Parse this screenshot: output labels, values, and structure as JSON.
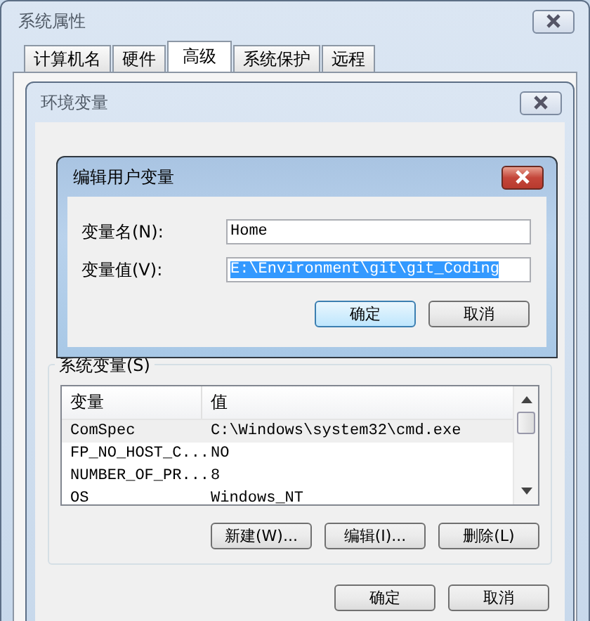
{
  "system_properties": {
    "title": "系统属性"
  },
  "tabs": [
    {
      "label": "计算机名",
      "selected": false
    },
    {
      "label": "硬件",
      "selected": false
    },
    {
      "label": "高级",
      "selected": true
    },
    {
      "label": "系统保护",
      "selected": false
    },
    {
      "label": "远程",
      "selected": false
    }
  ],
  "environment_variables": {
    "title": "环境变量",
    "system_variables": {
      "label": "系统变量(S)",
      "columns": [
        "变量",
        "值"
      ],
      "rows": [
        {
          "name": "ComSpec",
          "value": "C:\\Windows\\system32\\cmd.exe",
          "selected": true
        },
        {
          "name": "FP_NO_HOST_C...",
          "value": "NO",
          "selected": false
        },
        {
          "name": "NUMBER_OF_PR...",
          "value": "8",
          "selected": false
        },
        {
          "name": "OS",
          "value": "Windows_NT",
          "selected": false
        }
      ],
      "buttons": [
        "新建(W)...",
        "编辑(I)...",
        "删除(L)"
      ]
    },
    "buttons": [
      "确定",
      "取消"
    ]
  },
  "edit_dialog": {
    "title": "编辑用户变量",
    "fields": [
      {
        "label": "变量名(N):",
        "value": "Home",
        "selected": false
      },
      {
        "label": "变量值(V):",
        "value": "E:\\Environment\\git\\git_Coding",
        "selected": true
      }
    ],
    "buttons": [
      {
        "label": "确定",
        "default": true
      },
      {
        "label": "取消",
        "default": false
      }
    ]
  }
}
